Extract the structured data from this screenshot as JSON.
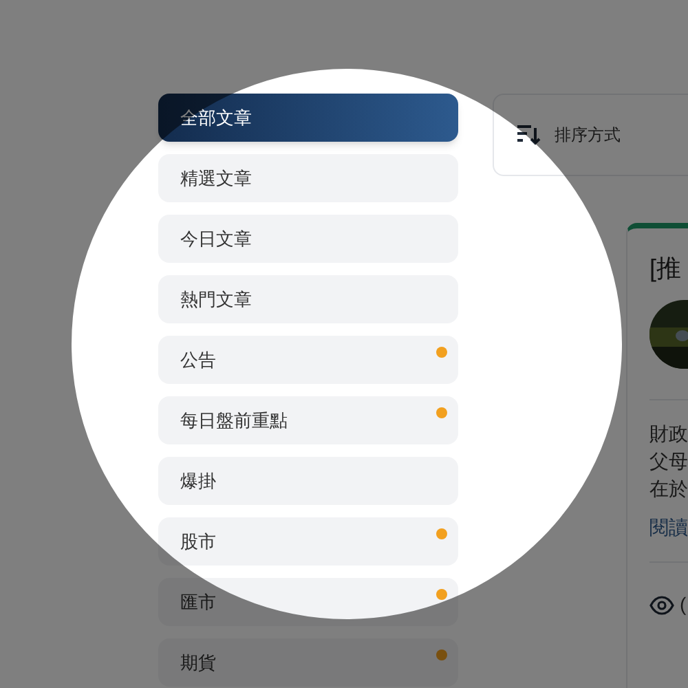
{
  "sidebar": {
    "items": [
      {
        "label": "全部文章",
        "selected": true,
        "has_dot": false
      },
      {
        "label": "精選文章",
        "selected": false,
        "has_dot": false
      },
      {
        "label": "今日文章",
        "selected": false,
        "has_dot": false
      },
      {
        "label": "熱門文章",
        "selected": false,
        "has_dot": false
      },
      {
        "label": "公告",
        "selected": false,
        "has_dot": true
      },
      {
        "label": "每日盤前重點",
        "selected": false,
        "has_dot": true
      },
      {
        "label": "爆掛",
        "selected": false,
        "has_dot": false
      },
      {
        "label": "股市",
        "selected": false,
        "has_dot": true
      },
      {
        "label": "匯市",
        "selected": false,
        "has_dot": true
      },
      {
        "label": "期貨",
        "selected": false,
        "has_dot": true
      }
    ]
  },
  "sort": {
    "label": "排序方式"
  },
  "article": {
    "title": "[推",
    "excerpt_lines": [
      "財政",
      "父母",
      "在於"
    ],
    "read_more": "閱讀",
    "views": "("
  }
}
